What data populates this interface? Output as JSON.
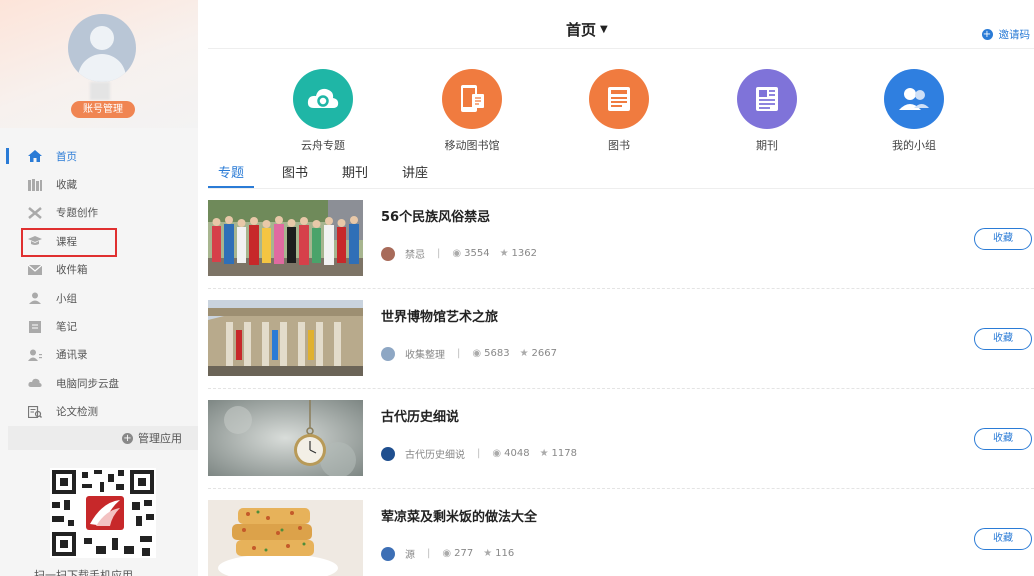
{
  "sidebar": {
    "account_button": "账号管理",
    "nav": [
      {
        "label": "首页",
        "icon": "home-icon",
        "active": true
      },
      {
        "label": "收藏",
        "icon": "bookshelf-icon"
      },
      {
        "label": "专题创作",
        "icon": "tools-icon"
      },
      {
        "label": "课程",
        "icon": "graduation-cap-icon"
      },
      {
        "label": "收件箱",
        "icon": "envelope-icon"
      },
      {
        "label": "小组",
        "icon": "person-icon"
      },
      {
        "label": "笔记",
        "icon": "notebook-icon"
      },
      {
        "label": "通讯录",
        "icon": "contacts-icon"
      },
      {
        "label": "电脑同步云盘",
        "icon": "cloud-icon"
      },
      {
        "label": "论文检测",
        "icon": "document-check-icon"
      }
    ],
    "manage_apps": "管理应用",
    "qr_caption": "扫一扫下载手机应用"
  },
  "header": {
    "title": "首页",
    "invite": "邀请码"
  },
  "quick_icons": [
    {
      "label": "云舟专题",
      "color": "#1fb6a6",
      "icon": "cloud-icon"
    },
    {
      "label": "移动图书馆",
      "color": "#f07b3f",
      "icon": "mobile-library-icon"
    },
    {
      "label": "图书",
      "color": "#f07b3f",
      "icon": "book-icon"
    },
    {
      "label": "期刊",
      "color": "#7f73d9",
      "icon": "journal-icon"
    },
    {
      "label": "我的小组",
      "color": "#2f7fe0",
      "icon": "group-icon"
    }
  ],
  "tabs": [
    "专题",
    "图书",
    "期刊",
    "讲座"
  ],
  "feed": [
    {
      "title": "56个民族风俗禁忌",
      "source": "禁忌",
      "views": "3554",
      "stars": "1362",
      "button": "收藏"
    },
    {
      "title": "世界博物馆艺术之旅",
      "source": "收集整理",
      "views": "5683",
      "stars": "2667",
      "button": "收藏"
    },
    {
      "title": "古代历史细说",
      "source": "古代历史细说",
      "views": "4048",
      "stars": "1178",
      "button": "收藏"
    },
    {
      "title": "荤凉菜及剩米饭的做法大全",
      "source": "源",
      "views": "277",
      "stars": "116",
      "button": "收藏"
    }
  ],
  "colors": {
    "accent": "#2a7bd6",
    "account_button": "#f08552",
    "highlight_box": "#e03030"
  }
}
